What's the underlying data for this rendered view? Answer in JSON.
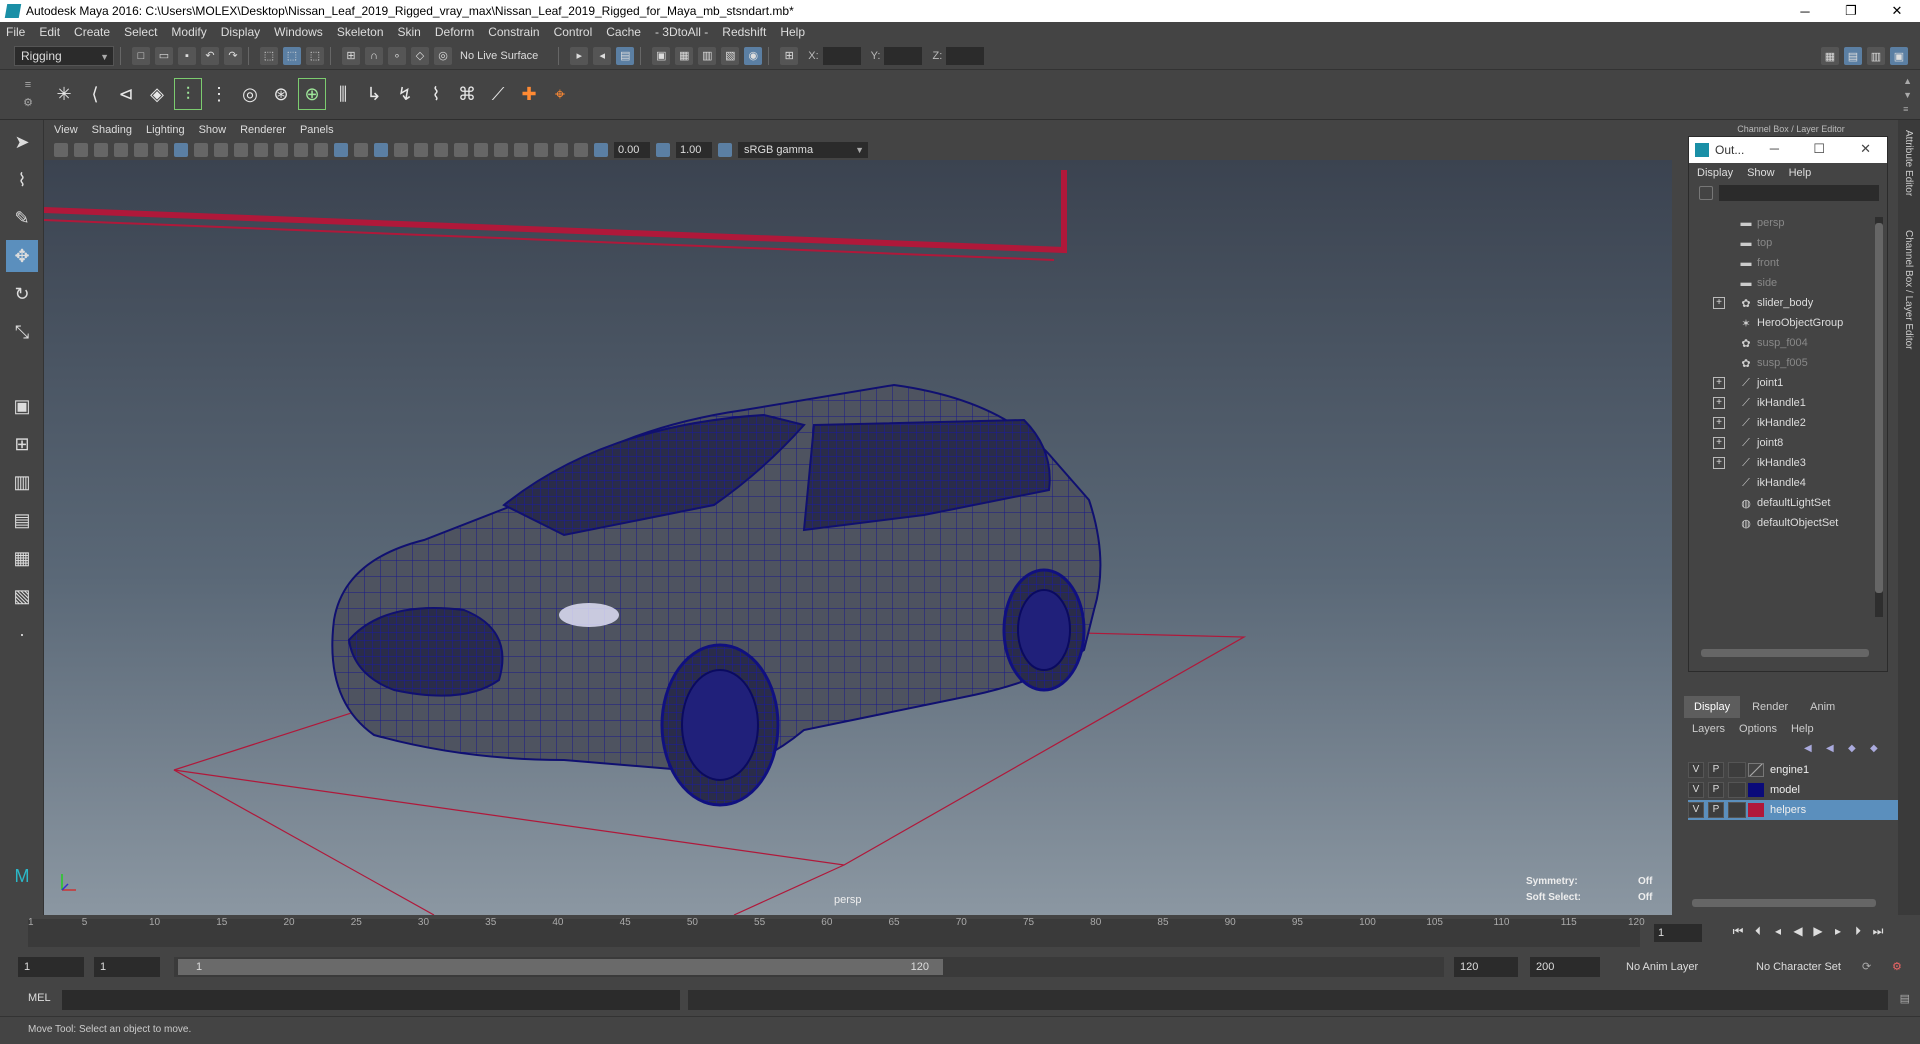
{
  "window": {
    "title": "Autodesk Maya 2016: C:\\Users\\MOLEX\\Desktop\\Nissan_Leaf_2019_Rigged_vray_max\\Nissan_Leaf_2019_Rigged_for_Maya_mb_stsndart.mb*",
    "minimize": "─",
    "restore": "❐",
    "close": "✕"
  },
  "menubar": [
    "File",
    "Edit",
    "Create",
    "Select",
    "Modify",
    "Display",
    "Windows",
    "Skeleton",
    "Skin",
    "Deform",
    "Constrain",
    "Control",
    "Cache",
    "- 3DtoAll -",
    "Redshift",
    "Help"
  ],
  "statusline": {
    "mode": "Rigging",
    "live_surface": "No Live Surface",
    "x_label": "X:",
    "y_label": "Y:",
    "z_label": "Z:"
  },
  "viewport": {
    "menu": [
      "View",
      "Shading",
      "Lighting",
      "Show",
      "Renderer",
      "Panels"
    ],
    "exposure": "0.00",
    "gamma": "1.00",
    "color_management": "sRGB gamma",
    "camera_label": "persp",
    "symmetry_label": "Symmetry:",
    "symmetry_value": "Off",
    "soft_select_label": "Soft Select:",
    "soft_select_value": "Off"
  },
  "side_tabs": {
    "attribute_editor": "Attribute Editor",
    "channel_box": "Channel Box / Layer Editor"
  },
  "channel_box_header": "Channel Box / Layer Editor",
  "outliner": {
    "title": "Out...",
    "menu": [
      "Display",
      "Show",
      "Help"
    ],
    "items": [
      {
        "label": "persp",
        "icon": "camera-icon",
        "dim": true,
        "expandable": false
      },
      {
        "label": "top",
        "icon": "camera-icon",
        "dim": true,
        "expandable": false
      },
      {
        "label": "front",
        "icon": "camera-icon",
        "dim": true,
        "expandable": false
      },
      {
        "label": "side",
        "icon": "camera-icon",
        "dim": true,
        "expandable": false
      },
      {
        "label": "slider_body",
        "icon": "transform-icon",
        "dim": false,
        "expandable": true
      },
      {
        "label": "HeroObjectGroup",
        "icon": "star-icon",
        "dim": false,
        "expandable": false
      },
      {
        "label": "susp_f004",
        "icon": "transform-icon",
        "dim": true,
        "expandable": false
      },
      {
        "label": "susp_f005",
        "icon": "transform-icon",
        "dim": true,
        "expandable": false
      },
      {
        "label": "joint1",
        "icon": "joint-icon",
        "dim": false,
        "expandable": true
      },
      {
        "label": "ikHandle1",
        "icon": "ik-handle-icon",
        "dim": false,
        "expandable": true
      },
      {
        "label": "ikHandle2",
        "icon": "ik-handle-icon",
        "dim": false,
        "expandable": true
      },
      {
        "label": "joint8",
        "icon": "joint-icon",
        "dim": false,
        "expandable": true
      },
      {
        "label": "ikHandle3",
        "icon": "ik-handle-icon",
        "dim": false,
        "expandable": true
      },
      {
        "label": "ikHandle4",
        "icon": "ik-handle-icon",
        "dim": false,
        "expandable": false
      },
      {
        "label": "defaultLightSet",
        "icon": "set-icon",
        "dim": false,
        "expandable": false
      },
      {
        "label": "defaultObjectSet",
        "icon": "set-icon",
        "dim": false,
        "expandable": false
      }
    ]
  },
  "layer_editor": {
    "tabs": [
      "Display",
      "Render",
      "Anim"
    ],
    "menu": [
      "Layers",
      "Options",
      "Help"
    ],
    "layers": [
      {
        "v": "V",
        "p": "P",
        "name": "engine1",
        "color": "none",
        "selected": false
      },
      {
        "v": "V",
        "p": "P",
        "name": "model",
        "color": "#0a0a7a",
        "selected": false
      },
      {
        "v": "V",
        "p": "P",
        "name": "helpers",
        "color": "#b0183a",
        "selected": true
      }
    ]
  },
  "timeslider": {
    "ticks": [
      "1",
      "5",
      "10",
      "15",
      "20",
      "25",
      "30",
      "35",
      "40",
      "45",
      "50",
      "55",
      "60",
      "65",
      "70",
      "75",
      "80",
      "85",
      "90",
      "95",
      "100",
      "105",
      "110",
      "115",
      "120"
    ],
    "current_frame": "1"
  },
  "rangeslider": {
    "start_time": "1",
    "playback_start": "1",
    "range_start": "1",
    "range_end": "120",
    "playback_end": "120",
    "end_time": "200",
    "anim_layer": "No Anim Layer",
    "character_set": "No Character Set"
  },
  "command_line": {
    "label": "MEL"
  },
  "help_line": "Move Tool: Select an object to move."
}
